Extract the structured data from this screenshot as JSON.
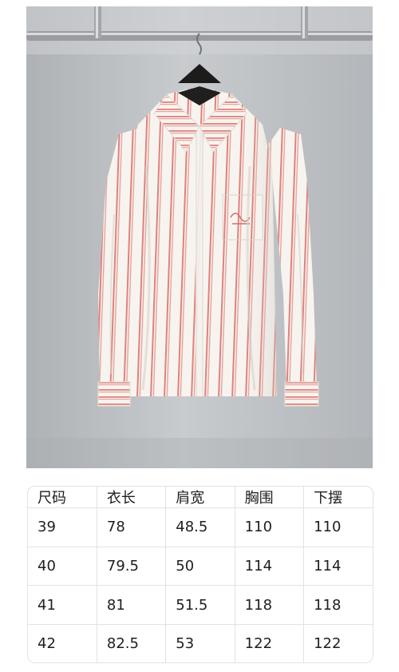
{
  "photo": {
    "subject": "striped-shirt-photo"
  },
  "size_table": {
    "headers": [
      "尺码",
      "衣长",
      "肩宽",
      "胸围",
      "下摆"
    ],
    "rows": [
      [
        "39",
        "78",
        "48.5",
        "110",
        "110"
      ],
      [
        "40",
        "79.5",
        "50",
        "114",
        "114"
      ],
      [
        "41",
        "81",
        "51.5",
        "118",
        "118"
      ],
      [
        "42",
        "82.5",
        "53",
        "122",
        "122"
      ]
    ]
  },
  "colors": {
    "stripe": "#e0817d",
    "shirt": "#f7f4ef",
    "wall": "#bcbfc3",
    "table_border": "#e2e2e2"
  }
}
